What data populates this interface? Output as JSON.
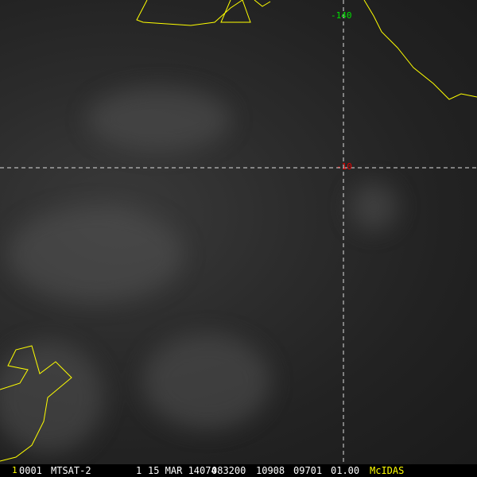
{
  "image": {
    "satellite": "MTSAT-2",
    "frame_marker": "1",
    "frame": "0001",
    "band": "1",
    "date": "15 MAR 14074",
    "time": "083200",
    "line": "10908",
    "element": "09701",
    "resolution": "01.00",
    "software": "McIDAS"
  },
  "grid": {
    "longitude_label": "-140",
    "latitude_label": "-10"
  },
  "colors": {
    "coast": "#ffff00",
    "grid_lon": "#00e000",
    "grid_lat": "#e00000",
    "dash": "#ffffff",
    "software": "#ffff00"
  }
}
